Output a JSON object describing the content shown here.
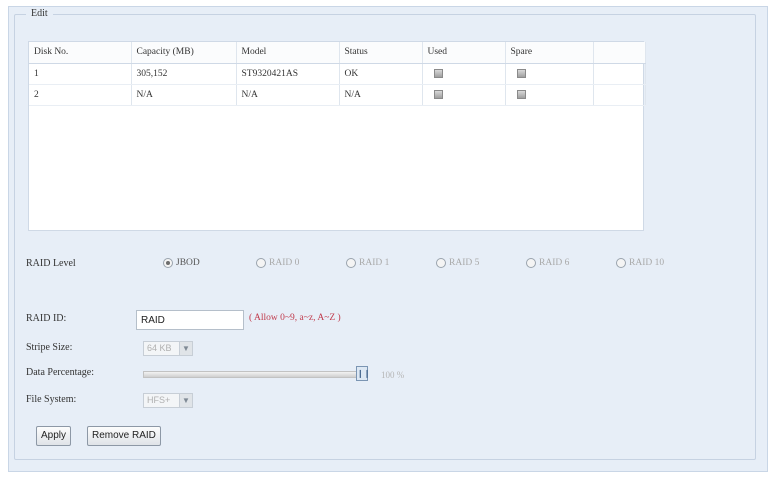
{
  "section_title": "Edit",
  "disk_table": {
    "headers": [
      "Disk No.",
      "Capacity (MB)",
      "Model",
      "Status",
      "Used",
      "Spare"
    ],
    "rows": [
      {
        "disk_no": "1",
        "capacity": "305,152",
        "model": "ST9320421AS",
        "status": "OK"
      },
      {
        "disk_no": "2",
        "capacity": "N/A",
        "model": "N/A",
        "status": "N/A"
      }
    ]
  },
  "raid_level": {
    "label": "RAID Level",
    "options": [
      "JBOD",
      "RAID 0",
      "RAID 1",
      "RAID 5",
      "RAID 6",
      "RAID 10"
    ],
    "selected": "JBOD"
  },
  "raid_id": {
    "label": "RAID ID:",
    "value": "RAID",
    "hint": "( Allow 0~9, a~z, A~Z )"
  },
  "stripe_size": {
    "label": "Stripe Size:",
    "value": "64 KB"
  },
  "data_percentage": {
    "label": "Data Percentage:",
    "value_text": "100 %",
    "value": 100
  },
  "file_system": {
    "label": "File System:",
    "value": "HFS+"
  },
  "buttons": {
    "apply": "Apply",
    "remove": "Remove RAID"
  },
  "colors": {
    "background": "#e7eef7",
    "hint": "#c0394b"
  }
}
